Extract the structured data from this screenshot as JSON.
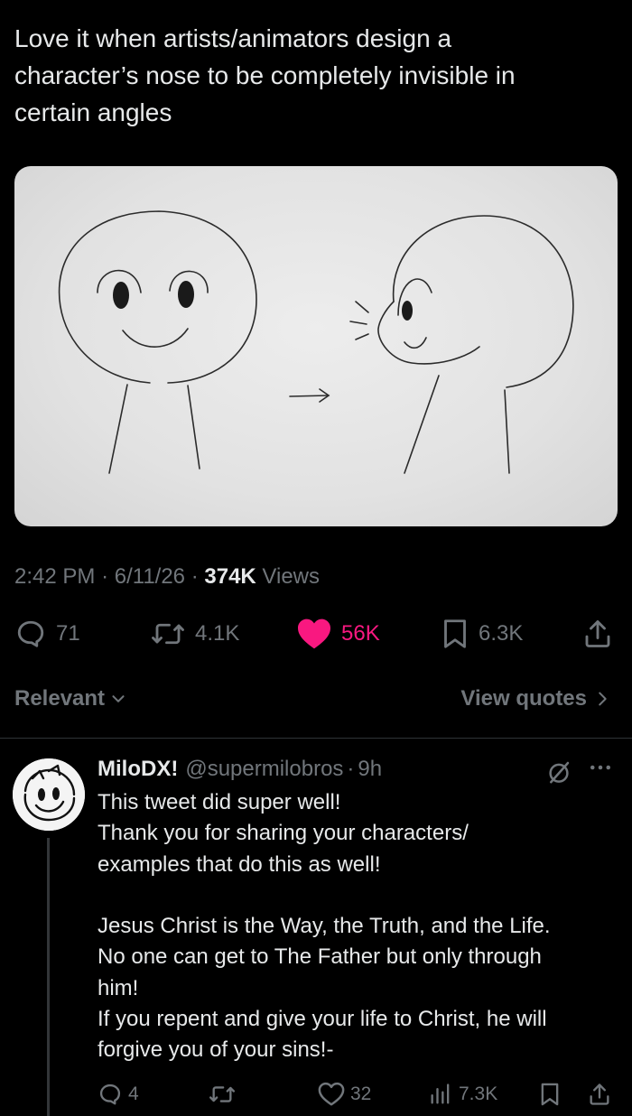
{
  "tweet": {
    "text": "Love it when artists/animators design a\ncharacter’s nose to be completely invisible in\ncertain angles",
    "time": "2:42 PM",
    "date": "6/11/26",
    "views_count": "374K",
    "views_label": "Views"
  },
  "actions": {
    "replies": "71",
    "reposts": "4.1K",
    "likes": "56K",
    "bookmarks": "6.3K"
  },
  "sort": {
    "relevant_label": "Relevant",
    "view_quotes_label": "View quotes"
  },
  "reply": {
    "name": "MiloDX!",
    "handle": "@supermilobros",
    "time": "9h",
    "text": "This tweet did super well!\nThank you for sharing your characters/\nexamples that do this as well!\n\nJesus Christ is the Way, the Truth, and the Life.\nNo one can get to The Father but only through\nhim!\nIf you repent and give your life to Christ, he will\nforgive you of your sins!-",
    "replies": "4",
    "reposts": "",
    "likes": "32",
    "views": "7.3K"
  },
  "colors": {
    "background": "#000000",
    "text_primary": "#e7e9ea",
    "text_secondary": "#71767b",
    "like_pink": "#f91880",
    "divider": "#2f3336"
  },
  "icons": [
    "reply-icon",
    "repost-icon",
    "heart-filled-icon",
    "bookmark-icon",
    "share-icon",
    "chevron-down-icon",
    "chevron-right-icon",
    "grok-icon",
    "more-icon",
    "heart-icon",
    "views-icon"
  ]
}
